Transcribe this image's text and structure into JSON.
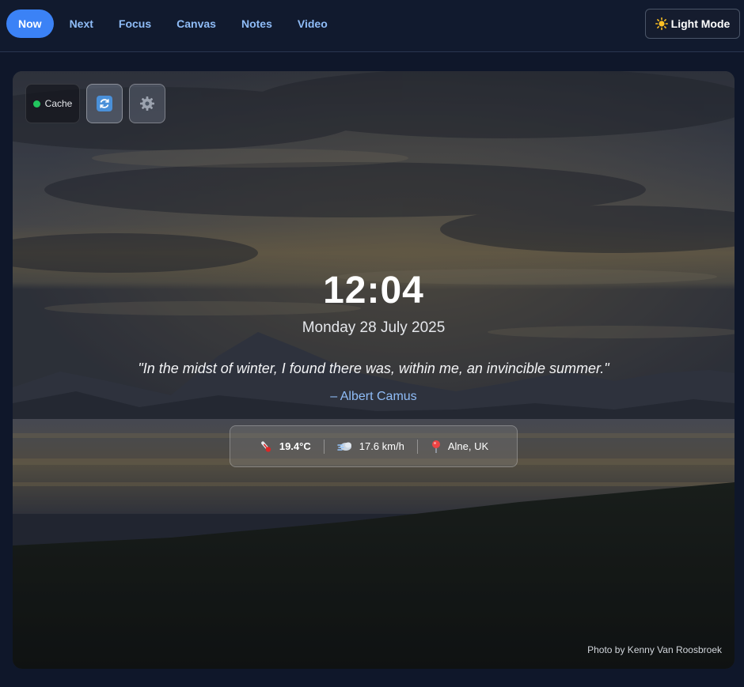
{
  "nav": {
    "tabs": [
      {
        "label": "Now",
        "active": true
      },
      {
        "label": "Next",
        "active": false
      },
      {
        "label": "Focus",
        "active": false
      },
      {
        "label": "Canvas",
        "active": false
      },
      {
        "label": "Notes",
        "active": false
      },
      {
        "label": "Video",
        "active": false
      }
    ],
    "mode_button": {
      "label": "Light Mode",
      "icon": "sun-icon"
    }
  },
  "controls": {
    "cache_label": "Cache",
    "cache_status_color": "#22c55e",
    "refresh_icon": "refresh-icon",
    "settings_icon": "gear-icon"
  },
  "hero": {
    "time": "12:04",
    "date": "Monday 28 July 2025",
    "quote": "\"In the midst of winter, I found there was, within me, an invincible summer.\"",
    "author": "– Albert Camus",
    "weather": {
      "temperature": "19.4°C",
      "wind": "17.6 km/h",
      "location": "Alne, UK"
    },
    "photo_credit": "Photo by Kenny Van Roosbroek"
  },
  "colors": {
    "accent": "#3b82f6",
    "link": "#8fbcf7",
    "background": "#0f172a"
  }
}
